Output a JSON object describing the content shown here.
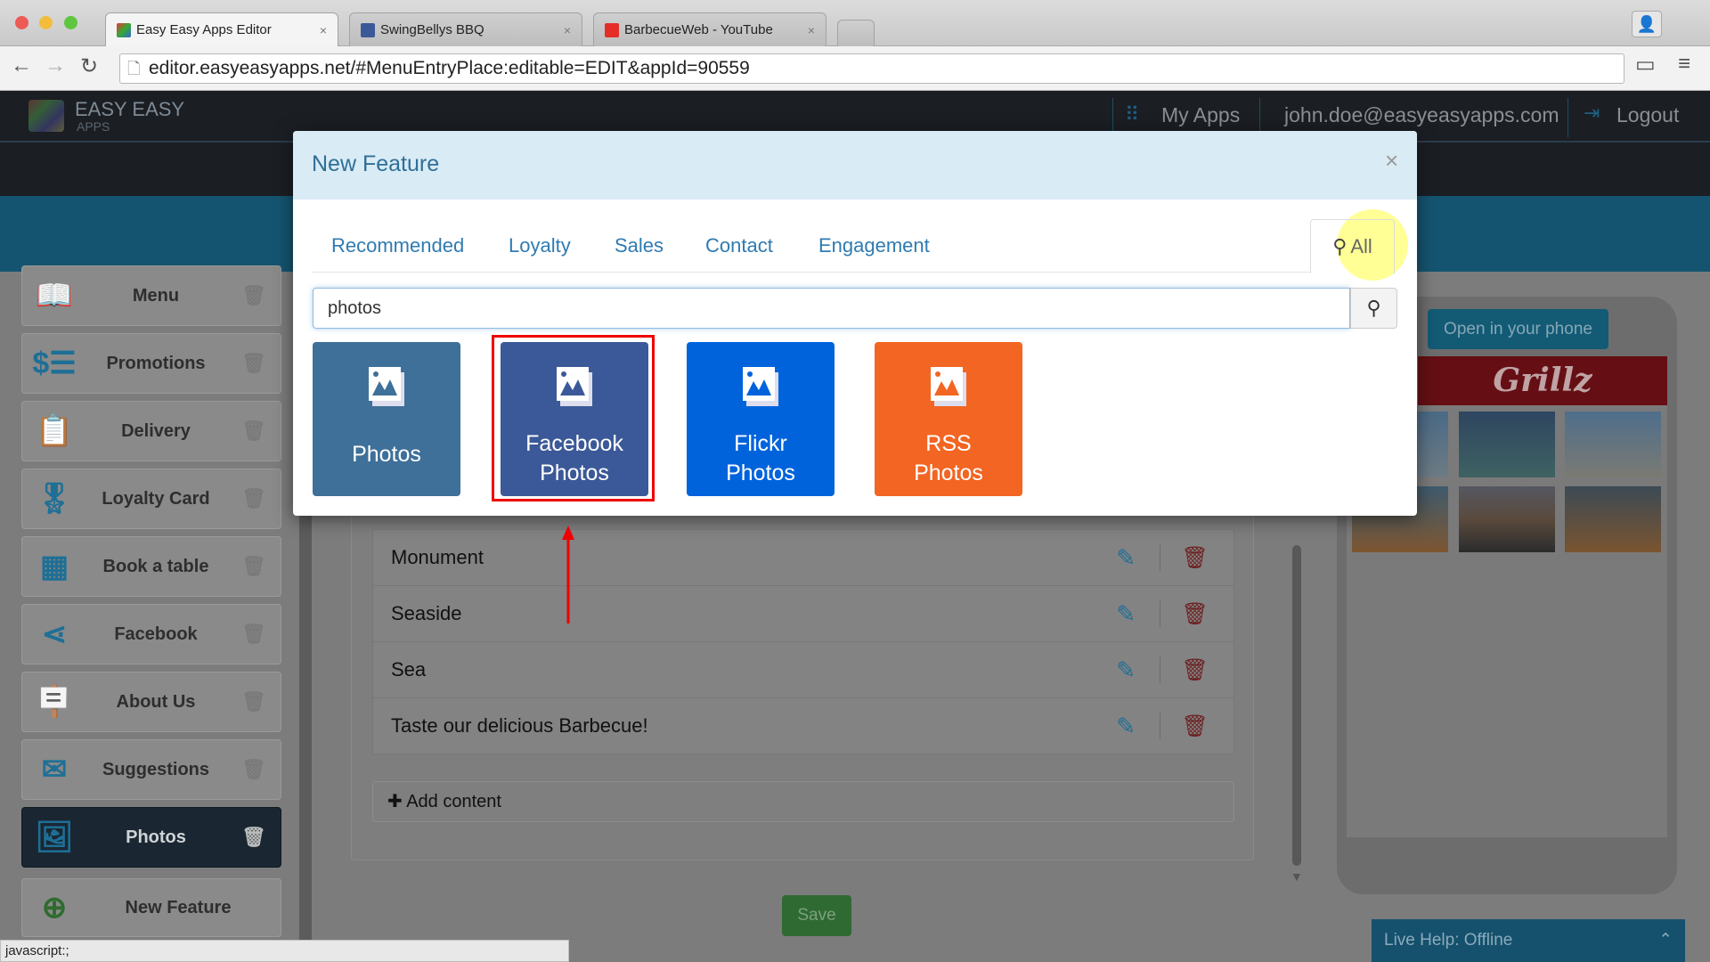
{
  "browser": {
    "tabs": [
      {
        "label": "Easy Easy Apps Editor",
        "active": true,
        "icon": "easyeasy-favicon"
      },
      {
        "label": "SwingBellys BBQ",
        "active": false,
        "icon": "facebook-favicon"
      },
      {
        "label": "BarbecueWeb - YouTube",
        "active": false,
        "icon": "youtube-favicon"
      }
    ],
    "tab_close": "×",
    "url": "editor.easyeasyapps.net/#MenuEntryPlace:editable=EDIT&appId=90559",
    "status_text": "javascript:;"
  },
  "header": {
    "logo_line1": "EASY EASY",
    "logo_line2": "APPS",
    "my_apps": "My Apps",
    "user_email": "john.doe@easyeasyapps.com",
    "logout": "Logout"
  },
  "sidebar": {
    "items": [
      {
        "label": "Menu",
        "icon": "book-icon"
      },
      {
        "label": "Promotions",
        "icon": "receipt-icon"
      },
      {
        "label": "Delivery",
        "icon": "clipboard-icon"
      },
      {
        "label": "Loyalty Card",
        "icon": "ribbon-icon"
      },
      {
        "label": "Book a table",
        "icon": "calendar-icon"
      },
      {
        "label": "Facebook",
        "icon": "share-icon"
      },
      {
        "label": "About Us",
        "icon": "open-sign-icon"
      },
      {
        "label": "Suggestions",
        "icon": "envelope-icon"
      },
      {
        "label": "Photos",
        "icon": "image-icon",
        "selected": true
      }
    ],
    "new_feature": "New Feature"
  },
  "content": {
    "rows": [
      "Monument",
      "Seaside",
      "Sea",
      "Taste our delicious Barbecue!"
    ],
    "add_content": "Add content",
    "save": "Save"
  },
  "preview": {
    "open_in_phone": "Open in your phone",
    "brand": "Grillz"
  },
  "live_help": "Live Help: Offline",
  "modal": {
    "title": "New Feature",
    "close": "×",
    "tabs": [
      "Recommended",
      "Loyalty",
      "Sales",
      "Contact",
      "Engagement"
    ],
    "all_tab": "All",
    "search_value": "photos",
    "tiles": [
      {
        "line1": "Photos",
        "line2": "",
        "color": "#3e7099"
      },
      {
        "line1": "Facebook",
        "line2": "Photos",
        "color": "#3b5998",
        "highlighted": true
      },
      {
        "line1": "Flickr",
        "line2": "Photos",
        "color": "#0063dc"
      },
      {
        "line1": "RSS",
        "line2": "Photos",
        "color": "#f26522"
      }
    ]
  },
  "colors": {
    "accent": "#2f7bb1",
    "highlight_box": "#ee0000"
  }
}
